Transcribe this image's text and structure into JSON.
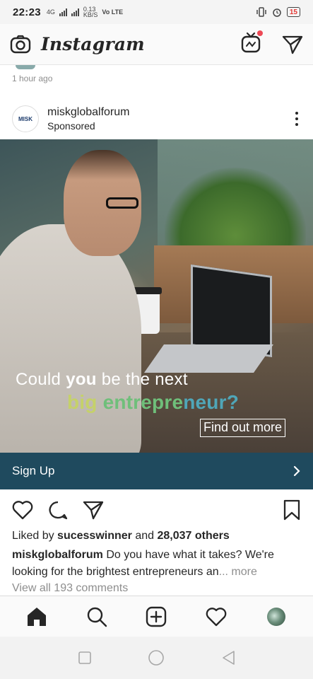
{
  "status_bar": {
    "time": "22:23",
    "net1": "4G",
    "speed_value": "0.13",
    "speed_unit": "KB/S",
    "volte": "Vo LTE",
    "battery": "15"
  },
  "header": {
    "logo": "Instagram",
    "icons": [
      "camera-icon",
      "igtv-icon",
      "direct-message-icon"
    ],
    "igtv_badge_color": "#ed4956"
  },
  "previous_post": {
    "timestamp": "1 hour ago"
  },
  "post": {
    "username": "miskglobalforum",
    "sponsored": "Sponsored",
    "avatar_text": "MISK",
    "ad": {
      "line1_prefix": "Could ",
      "line1_bold": "you",
      "line1_suffix": " be the next",
      "line2_w1": "big",
      "line2_w2": " entrepre",
      "line2_w3": "neur?",
      "button": "Find out more"
    },
    "cta": {
      "label": "Sign Up",
      "color": "#1f4a5e"
    },
    "actions": [
      "heart-icon",
      "comment-icon",
      "share-icon",
      "bookmark-icon"
    ],
    "likes": {
      "prefix": "Liked by ",
      "user": "sucesswinner",
      "mid": " and ",
      "count": "28,037 others"
    },
    "caption": {
      "user": "miskglobalforum",
      "text": " Do you have what it takes? We're looking for the brightest entrepreneurs an",
      "ellipsis": "...",
      "more": " more"
    },
    "view_comments": "View all 193 comments"
  },
  "bottom_nav": [
    "home-icon",
    "search-icon",
    "new-post-icon",
    "activity-heart-icon",
    "profile-avatar"
  ],
  "system_nav": [
    "recents-square-icon",
    "home-circle-icon",
    "back-triangle-icon"
  ]
}
